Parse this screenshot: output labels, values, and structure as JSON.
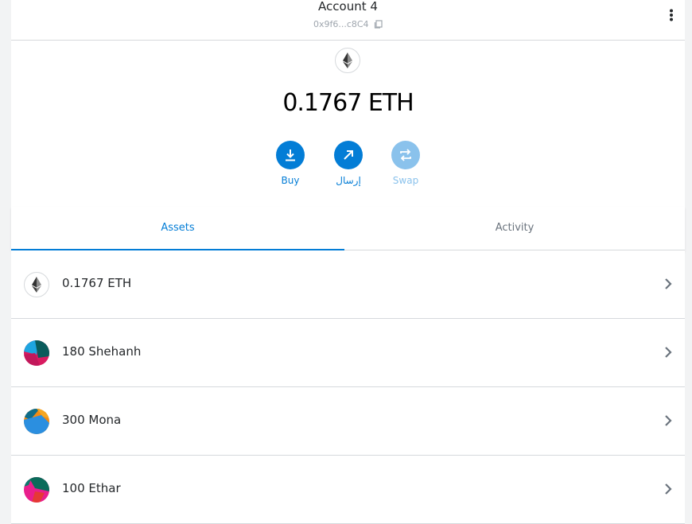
{
  "header": {
    "account_name": "Account 4",
    "address_short": "0x9f6...c8C4",
    "menu_icon": "kebab-menu-icon",
    "copy_icon": "copy-icon"
  },
  "balance": {
    "amount": "0.1767",
    "unit": "ETH",
    "token_icon": "ethereum-icon"
  },
  "actions": [
    {
      "label": "Buy",
      "icon": "download-icon",
      "enabled": true
    },
    {
      "label": "إرسال",
      "icon": "arrow-up-right-icon",
      "enabled": true
    },
    {
      "label": "Swap",
      "icon": "swap-icon",
      "enabled": false
    }
  ],
  "tabs": [
    {
      "label": "Assets",
      "active": true
    },
    {
      "label": "Activity",
      "active": false
    }
  ],
  "assets": [
    {
      "label": "0.1767 ETH",
      "icon": "ethereum-icon"
    },
    {
      "label": "180 Shehanh",
      "icon": "jazzicon-shehanh"
    },
    {
      "label": "300 Mona",
      "icon": "jazzicon-mona"
    },
    {
      "label": "100 Ethar",
      "icon": "jazzicon-ethar"
    }
  ],
  "colors": {
    "accent": "#037dd6",
    "accent_disabled": "#8ac2ec",
    "text": "#24272a",
    "muted": "#9fa6ae",
    "border": "#d6d9dc"
  }
}
